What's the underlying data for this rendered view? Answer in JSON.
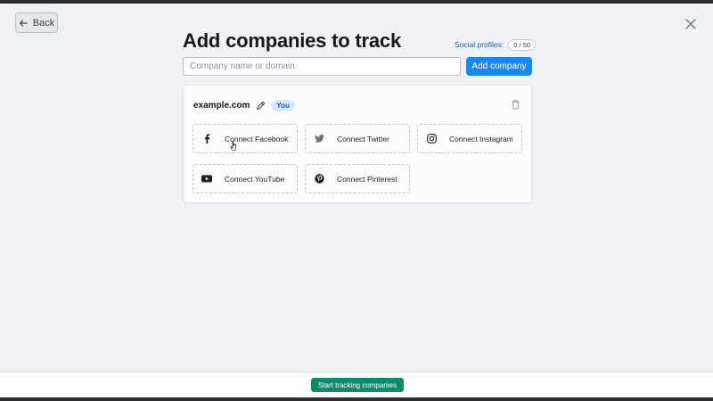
{
  "header": {
    "back_label": "Back",
    "title": "Add companies to track"
  },
  "social_profiles": {
    "label": "Social profiles:",
    "count": "0 / 50"
  },
  "search": {
    "placeholder": "Company name or domain",
    "value": ""
  },
  "add_company_label": "Add company",
  "company": {
    "name": "example.com",
    "badge": "You",
    "connections": [
      {
        "label": "Connect Facebook",
        "icon": "facebook-icon"
      },
      {
        "label": "Connect Twitter",
        "icon": "twitter-icon"
      },
      {
        "label": "Connect Instagram",
        "icon": "instagram-icon"
      },
      {
        "label": "Connect YouTube",
        "icon": "youtube-icon"
      },
      {
        "label": "Connect Pinterest",
        "icon": "pinterest-icon"
      }
    ]
  },
  "footer": {
    "start_label": "Start tracking companies"
  },
  "colors": {
    "accent_blue": "#1a86f0",
    "start_green": "#0f8a6b",
    "badge_bg": "#d7e9fb"
  }
}
